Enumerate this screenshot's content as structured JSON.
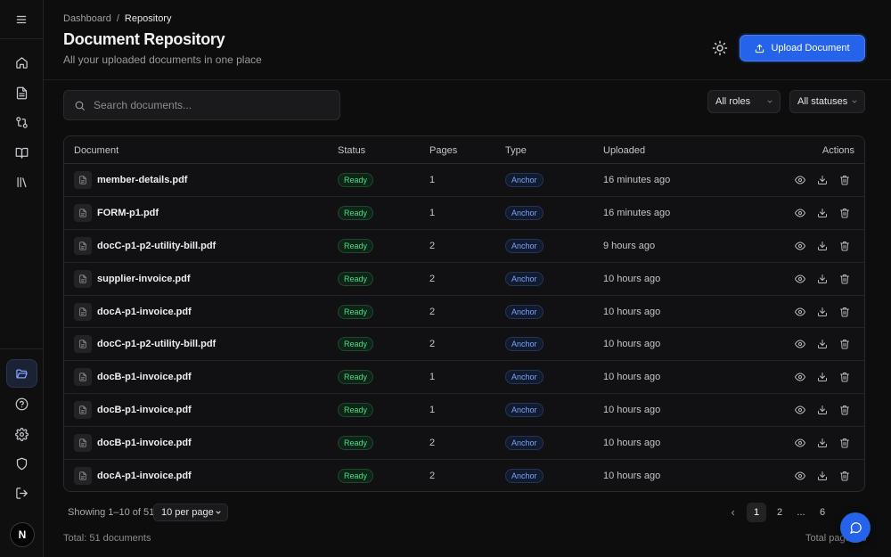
{
  "breadcrumb": {
    "root": "Dashboard",
    "sep": "/",
    "current": "Repository"
  },
  "header": {
    "title": "Document Repository",
    "subtitle": "All your uploaded documents in one place",
    "upload_label": "Upload Document"
  },
  "search": {
    "placeholder": "Search documents..."
  },
  "filters": {
    "roles": "All roles",
    "statuses": "All statuses"
  },
  "table": {
    "columns": {
      "document": "Document",
      "status": "Status",
      "pages": "Pages",
      "type": "Type",
      "uploaded": "Uploaded",
      "actions": "Actions"
    },
    "rows": [
      {
        "name": "member-details.pdf",
        "status": "Ready",
        "pages": "1",
        "type": "Anchor",
        "uploaded": "16 minutes ago"
      },
      {
        "name": "FORM-p1.pdf",
        "status": "Ready",
        "pages": "1",
        "type": "Anchor",
        "uploaded": "16 minutes ago"
      },
      {
        "name": "docC-p1-p2-utility-bill.pdf",
        "status": "Ready",
        "pages": "2",
        "type": "Anchor",
        "uploaded": "9 hours ago"
      },
      {
        "name": "supplier-invoice.pdf",
        "status": "Ready",
        "pages": "2",
        "type": "Anchor",
        "uploaded": "10 hours ago"
      },
      {
        "name": "docA-p1-invoice.pdf",
        "status": "Ready",
        "pages": "2",
        "type": "Anchor",
        "uploaded": "10 hours ago"
      },
      {
        "name": "docC-p1-p2-utility-bill.pdf",
        "status": "Ready",
        "pages": "2",
        "type": "Anchor",
        "uploaded": "10 hours ago"
      },
      {
        "name": "docB-p1-invoice.pdf",
        "status": "Ready",
        "pages": "1",
        "type": "Anchor",
        "uploaded": "10 hours ago"
      },
      {
        "name": "docB-p1-invoice.pdf",
        "status": "Ready",
        "pages": "1",
        "type": "Anchor",
        "uploaded": "10 hours ago"
      },
      {
        "name": "docB-p1-invoice.pdf",
        "status": "Ready",
        "pages": "2",
        "type": "Anchor",
        "uploaded": "10 hours ago"
      },
      {
        "name": "docA-p1-invoice.pdf",
        "status": "Ready",
        "pages": "2",
        "type": "Anchor",
        "uploaded": "10 hours ago"
      }
    ]
  },
  "footer": {
    "showing": "Showing 1–10 of 51",
    "per_page": "10 per page",
    "total": "Total: 51 documents",
    "total_pages": "Total pages: 6",
    "pages": [
      "1",
      "2",
      "...",
      "6"
    ]
  },
  "user": {
    "avatar_letter": "N"
  },
  "colors": {
    "accent": "#2563eb",
    "ready": "#4ade80",
    "anchor": "#7fa2ff",
    "background": "#0d0d0e"
  },
  "icons": {
    "sidebar_top": [
      "menu-icon",
      "home-icon",
      "file-text-icon",
      "git-compare-icon",
      "book-open-icon",
      "library-icon"
    ],
    "sidebar_bottom": [
      "folder-open-icon",
      "help-circle-icon",
      "settings-icon",
      "shield-icon",
      "log-out-icon"
    ],
    "row_actions": [
      "eye-icon",
      "download-icon",
      "trash-icon"
    ]
  }
}
